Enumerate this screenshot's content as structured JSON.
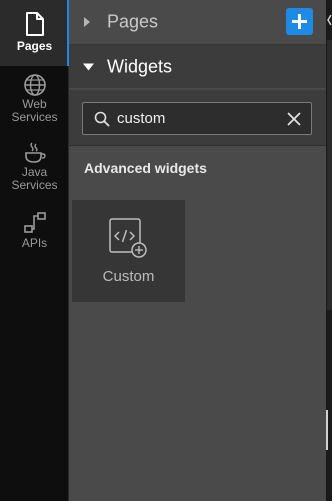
{
  "rail": {
    "items": [
      {
        "label": "Pages",
        "icon": "page-icon",
        "active": true
      },
      {
        "label": "Web Services",
        "icon": "globe-icon",
        "active": false
      },
      {
        "label": "Java Services",
        "icon": "coffee-icon",
        "active": false
      },
      {
        "label": "APIs",
        "icon": "api-icon",
        "active": false
      }
    ]
  },
  "sections": {
    "pages": {
      "title": "Pages",
      "expanded": false,
      "add_icon": "plus-icon"
    },
    "widgets": {
      "title": "Widgets",
      "expanded": true
    }
  },
  "search": {
    "value": "custom",
    "placeholder": ""
  },
  "category": {
    "label": "Advanced widgets"
  },
  "widgets": [
    {
      "label": "Custom",
      "icon": "custom-code-icon"
    }
  ],
  "colors": {
    "accent": "#1e8ae3",
    "rail_bg": "#0e0e0e",
    "panel_bg": "#4a4a4a"
  }
}
